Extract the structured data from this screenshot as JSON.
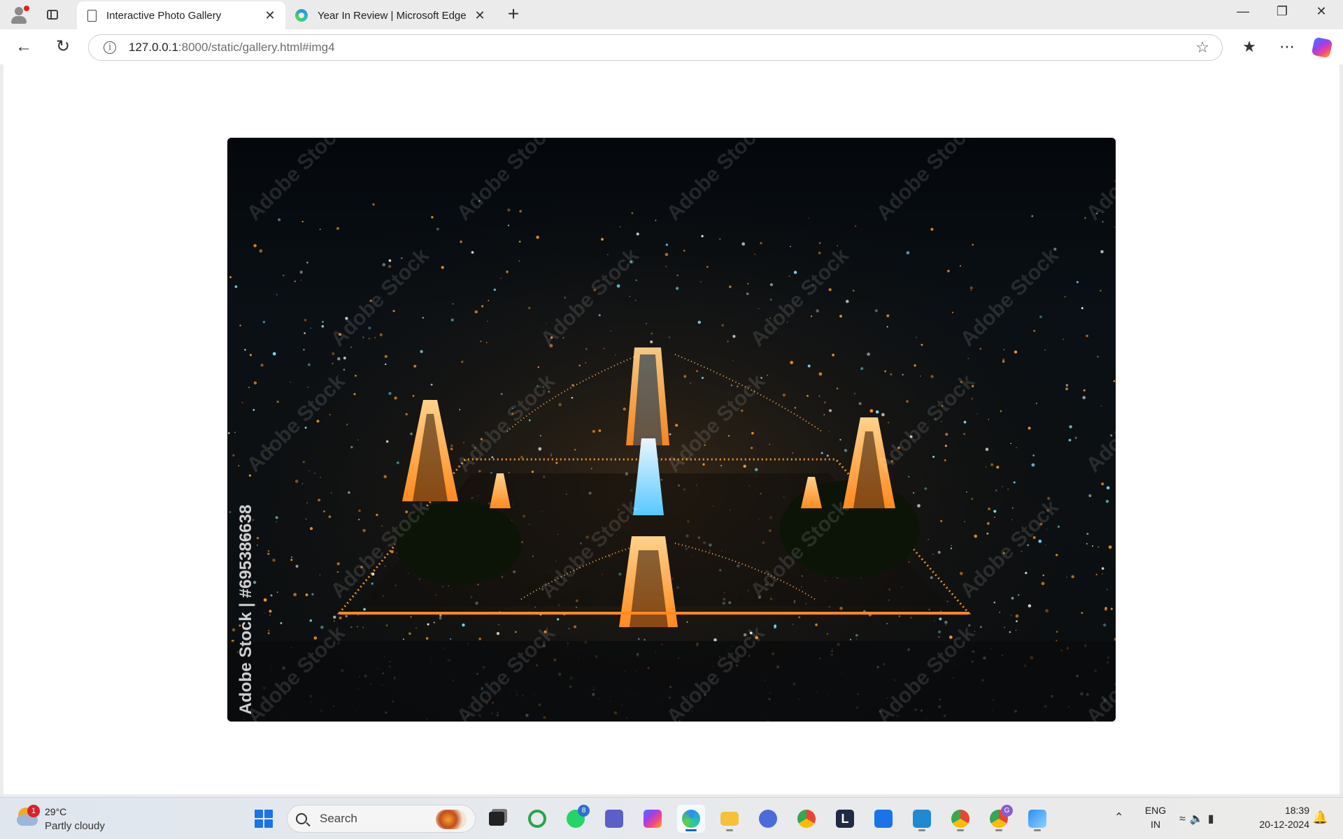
{
  "browser": {
    "tabs": [
      {
        "title": "Interactive Photo Gallery",
        "active": true,
        "icon": "page-icon"
      },
      {
        "title": "Year In Review | Microsoft Edge",
        "active": false,
        "icon": "edge-icon"
      }
    ],
    "address": {
      "host": "127.0.0.1",
      "rest": ":8000/static/gallery.html#img4"
    }
  },
  "gallery": {
    "image": {
      "watermark_side": "Adobe Stock | #695386638",
      "watermark_tile": "Adobe Stock",
      "description_alt": "Aerial night view of an illuminated temple complex"
    }
  },
  "taskbar": {
    "weather": {
      "temp": "29°C",
      "condition": "Partly cloudy",
      "badge": "1"
    },
    "search_label": "Search",
    "whatsapp_badge": "8",
    "chrome_profile_badge": "G",
    "language": {
      "line1": "ENG",
      "line2": "IN"
    },
    "clock": {
      "time": "18:39",
      "date": "20-12-2024"
    }
  },
  "colors": {
    "accent": "#0a64c2",
    "night_sky": "#06080b",
    "lights_orange": "#ff9a2e",
    "lights_cyan": "#7fe6ff"
  }
}
